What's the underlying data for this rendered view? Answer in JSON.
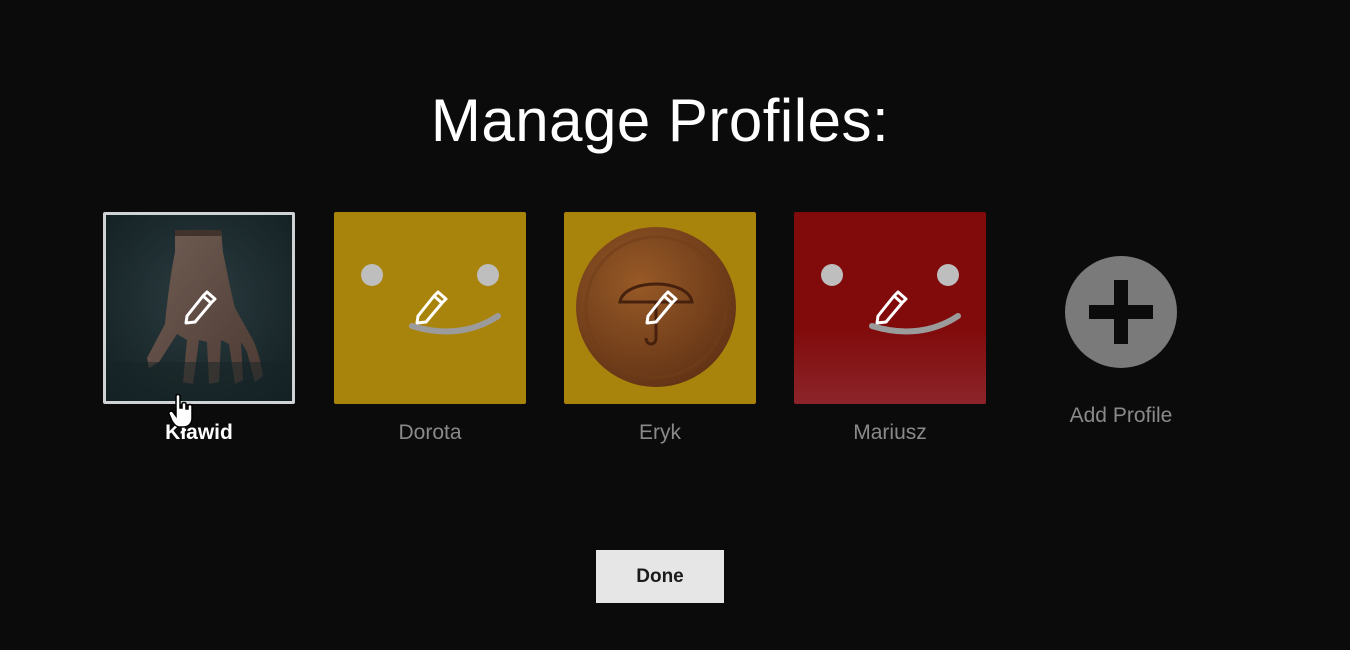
{
  "page": {
    "title": "Manage Profiles:"
  },
  "profiles": [
    {
      "name": "Kławid",
      "avatar": "hand-character-avatar",
      "edit_icon": "pencil-icon"
    },
    {
      "name": "Dorota",
      "avatar": "smiley-face-avatar",
      "edit_icon": "pencil-icon",
      "color": "#b8900e"
    },
    {
      "name": "Eryk",
      "avatar": "umbrella-coin-avatar",
      "edit_icon": "pencil-icon",
      "color": "#b8900e"
    },
    {
      "name": "Mariusz",
      "avatar": "smiley-face-avatar",
      "edit_icon": "pencil-icon",
      "color": "#8d0c0c"
    }
  ],
  "add_profile": {
    "label": "Add Profile",
    "icon": "plus-icon"
  },
  "done_button": {
    "label": "Done"
  },
  "colors": {
    "background": "#0b0b0b",
    "yellow_avatar": "#b8900e",
    "red_avatar": "#8d0c0c",
    "button_bg": "#e6e6e6"
  }
}
